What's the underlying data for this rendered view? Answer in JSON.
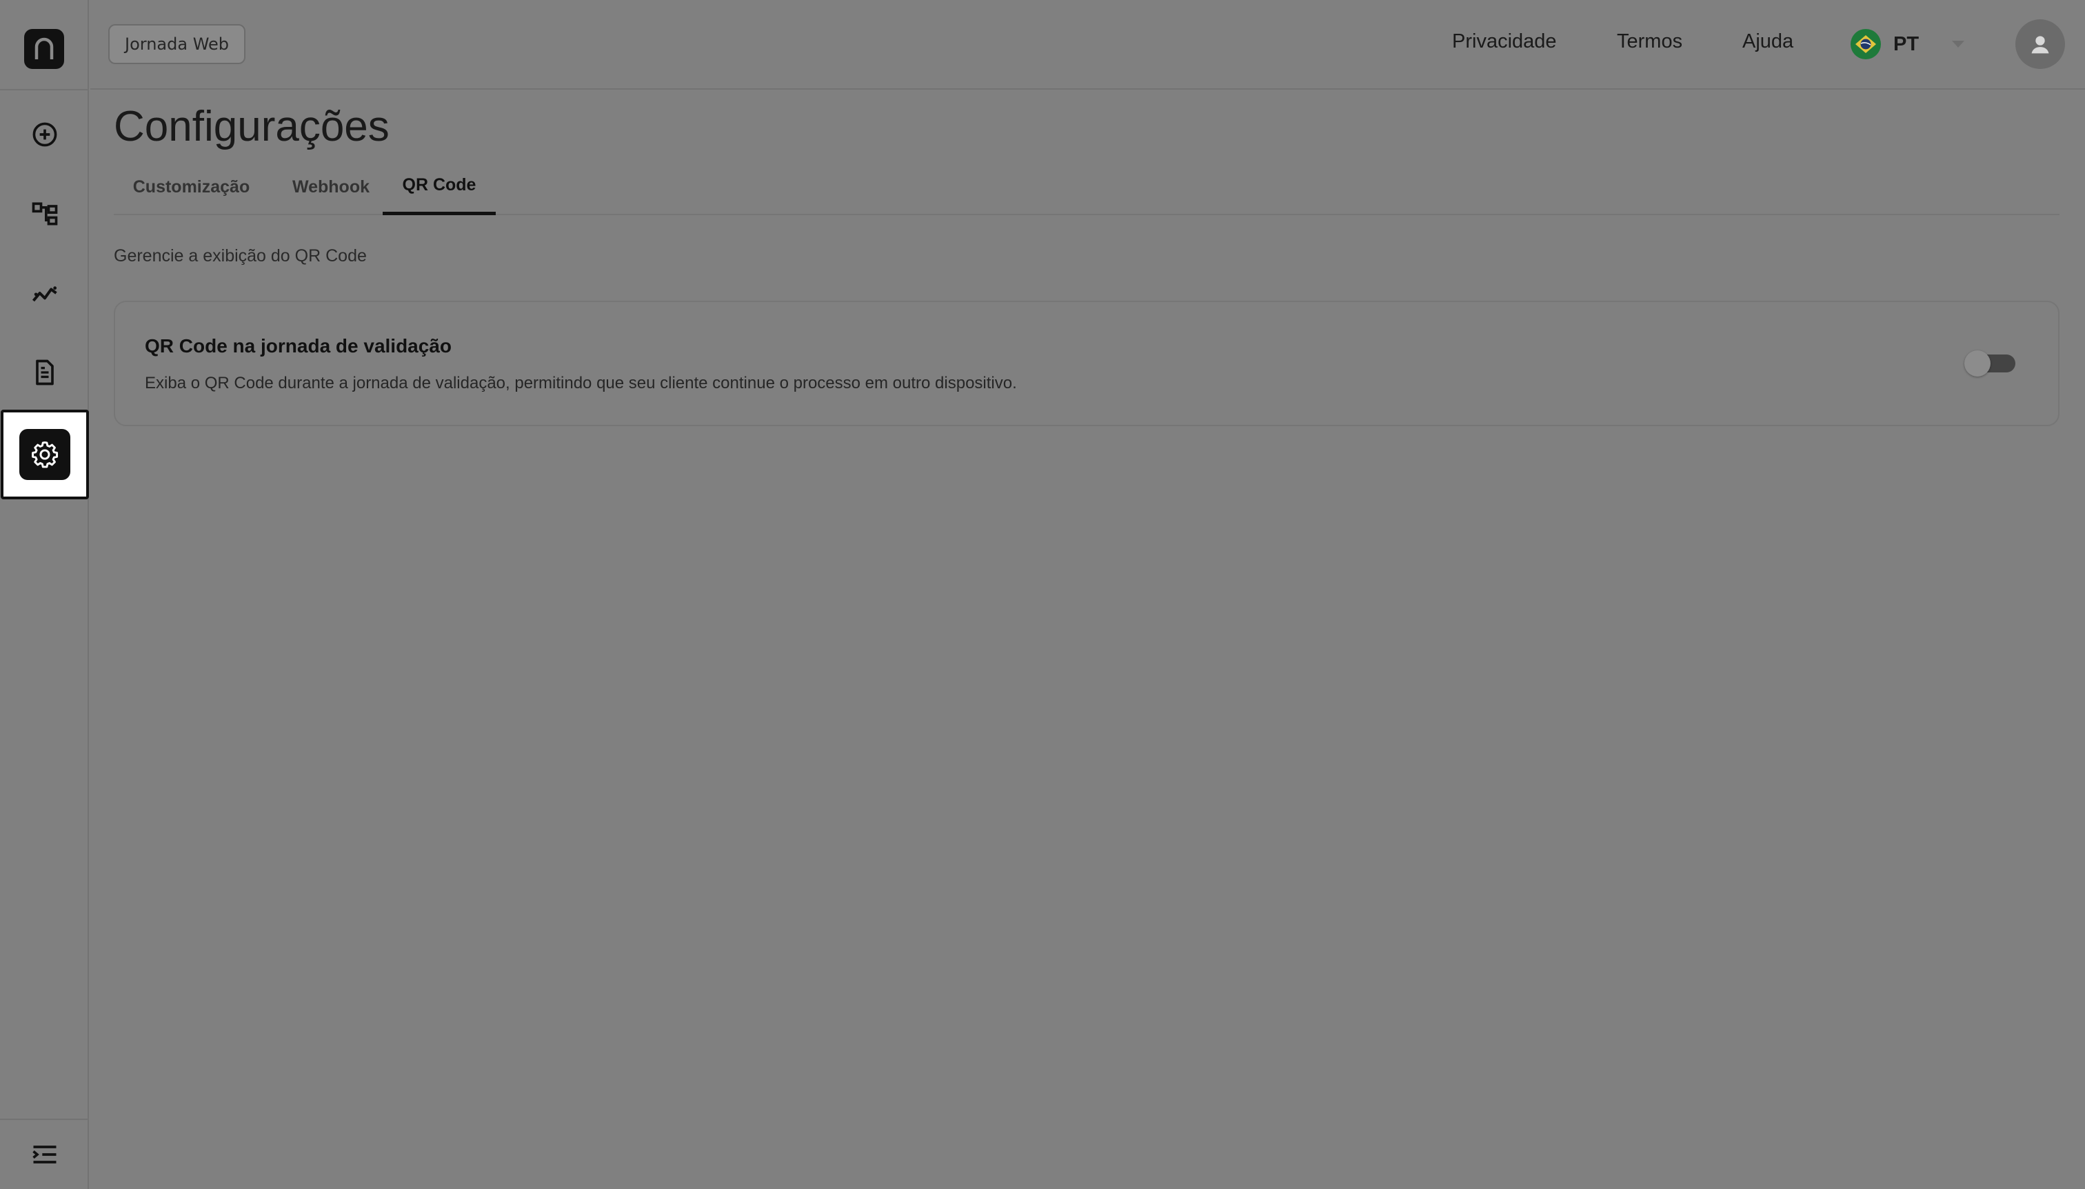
{
  "header": {
    "journey_chip": "Jornada Web",
    "links": {
      "privacy": "Privacidade",
      "terms": "Termos",
      "help": "Ajuda"
    },
    "language": {
      "code": "PT",
      "flag": "brazil-flag-icon"
    },
    "avatar_icon": "user-icon"
  },
  "sidebar": {
    "items": [
      {
        "icon": "plus-circle-icon"
      },
      {
        "icon": "flow-diagram-icon"
      },
      {
        "icon": "analytics-icon"
      },
      {
        "icon": "document-icon"
      },
      {
        "icon": "gear-icon",
        "active": true
      }
    ],
    "collapse_icon": "collapse-menu-icon"
  },
  "page": {
    "title": "Configurações",
    "tabs": [
      {
        "label": "Customização"
      },
      {
        "label": "Webhook"
      },
      {
        "label": "QR Code",
        "active": true
      }
    ],
    "description": "Gerencie a exibição do QR Code"
  },
  "qr_setting": {
    "title": "QR Code na jornada de validação",
    "text": "Exiba o QR Code durante a jornada de validação, permitindo que seu cliente continue o processo em outro dispositivo.",
    "enabled": false
  },
  "colors": {
    "background": "#808080",
    "accent": "#111111",
    "flag_green": "#1e7a3a"
  }
}
